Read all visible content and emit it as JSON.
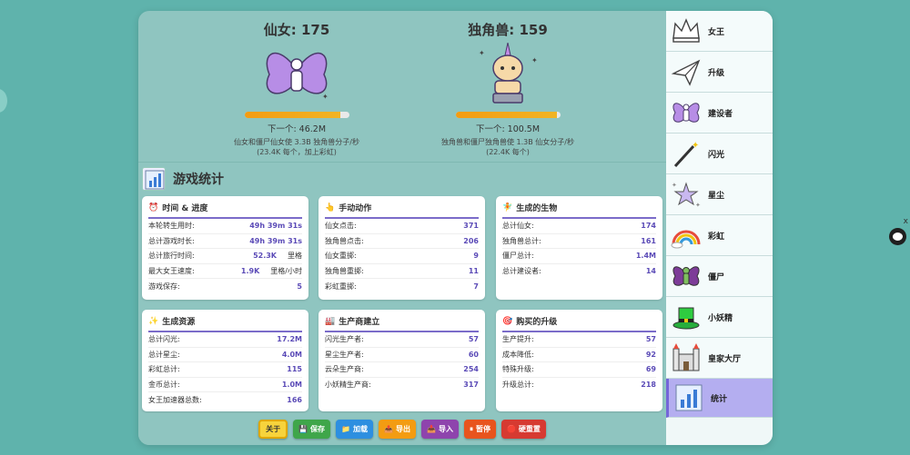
{
  "fairy": {
    "title": "仙女: 175",
    "progress": 0.92,
    "next": "下一个: 46.2M",
    "note1": "仙女和僵尸仙女使 3.3B 独角兽分子/秒",
    "note2": "(23.4K 每个，加上彩虹)"
  },
  "unicorn": {
    "title": "独角兽: 159",
    "progress": 0.97,
    "next": "下一个: 100.5M",
    "note1": "独角兽和僵尸独角兽使 1.3B 仙女分子/秒",
    "note2": "(22.4K 每个)"
  },
  "stats": {
    "title": "游戏统计",
    "time": {
      "icon": "⏰",
      "title": "时间 & 进度",
      "rows": [
        {
          "label": "本轮转生用时:",
          "value": "49h 39m 31s"
        },
        {
          "label": "总计游戏时长:",
          "value": "49h 39m 31s"
        },
        {
          "label": "总计旅行时间:",
          "value": "52.3K",
          "unit": "里格"
        },
        {
          "label": "最大女王速度:",
          "value": "1.9K",
          "unit": "里格/小时"
        },
        {
          "label": "游戏保存:",
          "value": "5"
        }
      ]
    },
    "manual": {
      "icon": "👆",
      "title": "手动动作",
      "rows": [
        {
          "label": "仙女点击:",
          "value": "371"
        },
        {
          "label": "独角兽点击:",
          "value": "206"
        },
        {
          "label": "仙女重掷:",
          "value": "9"
        },
        {
          "label": "独角兽重掷:",
          "value": "11"
        },
        {
          "label": "彩虹重掷:",
          "value": "7"
        }
      ]
    },
    "creatures": {
      "icon": "🧚",
      "title": "生成的生物",
      "rows": [
        {
          "label": "总计仙女:",
          "value": "174"
        },
        {
          "label": "独角兽总计:",
          "value": "161"
        },
        {
          "label": "僵尸总计:",
          "value": "1.4M"
        },
        {
          "label": "总计建设者:",
          "value": "14"
        }
      ]
    },
    "resources": {
      "icon": "✨",
      "title": "生成资源",
      "rows": [
        {
          "label": "总计闪光:",
          "value": "17.2M"
        },
        {
          "label": "总计星尘:",
          "value": "4.0M"
        },
        {
          "label": "彩虹总计:",
          "value": "115"
        },
        {
          "label": "金币总计:",
          "value": "1.0M"
        },
        {
          "label": "女王加速器总数:",
          "value": "166"
        }
      ]
    },
    "producers": {
      "icon": "🏭",
      "title": "生产商建立",
      "rows": [
        {
          "label": "闪光生产者:",
          "value": "57"
        },
        {
          "label": "星尘生产者:",
          "value": "60"
        },
        {
          "label": "云朵生产商:",
          "value": "254"
        },
        {
          "label": "小妖精生产商:",
          "value": "317"
        }
      ]
    },
    "upgrades": {
      "icon": "🎯",
      "title": "购买的升级",
      "rows": [
        {
          "label": "生产提升:",
          "value": "57"
        },
        {
          "label": "成本降低:",
          "value": "92"
        },
        {
          "label": "特殊升级:",
          "value": "69"
        },
        {
          "label": "升级总计:",
          "value": "218"
        }
      ]
    }
  },
  "toolbar": [
    {
      "label": "关于",
      "icon": "",
      "color": "#f7d33c",
      "text_color": "#333"
    },
    {
      "label": "保存",
      "icon": "💾",
      "color": "#3fa64a"
    },
    {
      "label": "加载",
      "icon": "📁",
      "color": "#2d8fe0"
    },
    {
      "label": "导出",
      "icon": "📤",
      "color": "#f39c12"
    },
    {
      "label": "导入",
      "icon": "📥",
      "color": "#8e44ad"
    },
    {
      "label": "暂停",
      "icon": "⏸",
      "color": "#e8541e"
    },
    {
      "label": "硬重置",
      "icon": "🛑",
      "color": "#d63a31"
    }
  ],
  "sidebar": [
    {
      "label": "女王",
      "icon": "crown-icon"
    },
    {
      "label": "升级",
      "icon": "paper-plane-icon"
    },
    {
      "label": "建设者",
      "icon": "fairy-icon"
    },
    {
      "label": "闪光",
      "icon": "magic-wand-icon"
    },
    {
      "label": "星尘",
      "icon": "star-dust-icon"
    },
    {
      "label": "彩虹",
      "icon": "rainbow-icon"
    },
    {
      "label": "僵尸",
      "icon": "zombie-fairy-icon"
    },
    {
      "label": "小妖精",
      "icon": "leprechaun-hat-icon"
    },
    {
      "label": "皇家大厅",
      "icon": "castle-icon"
    },
    {
      "label": "统计",
      "icon": "stats-board-icon",
      "active": true
    }
  ]
}
